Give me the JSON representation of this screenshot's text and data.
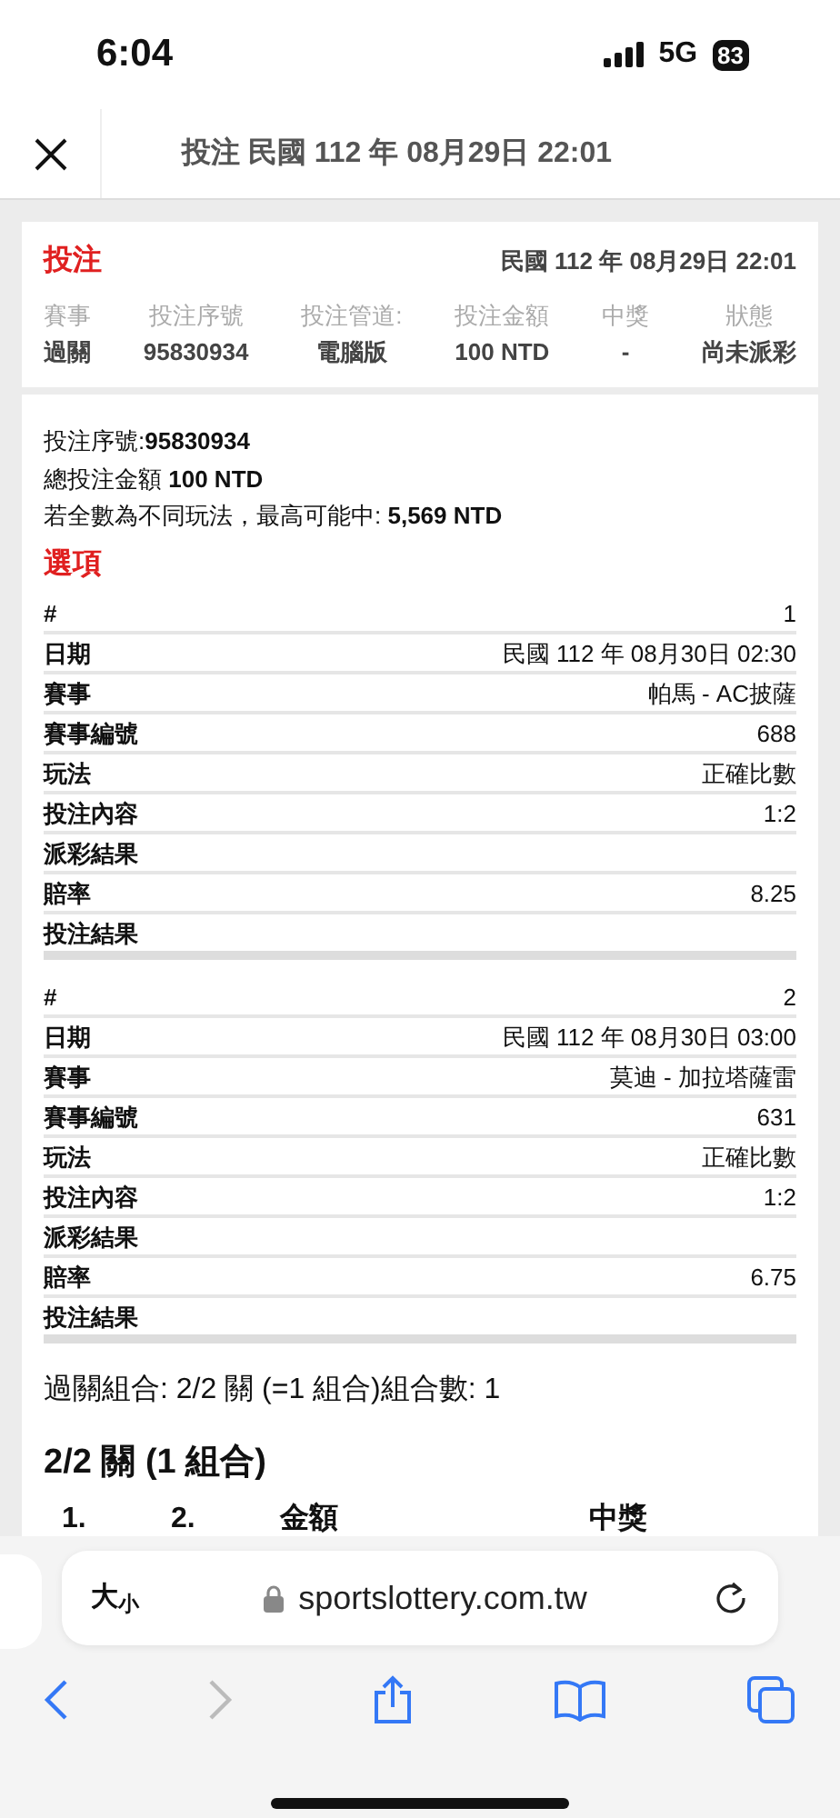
{
  "status_bar": {
    "time": "6:04",
    "network": "5G",
    "battery": "83"
  },
  "header": {
    "title": "投注 民國 112 年 08月29日 22:01"
  },
  "summary": {
    "title": "投注",
    "date": "民國 112 年 08月29日 22:01",
    "columns": [
      {
        "label": "賽事",
        "value": "過關"
      },
      {
        "label": "投注序號",
        "value": "95830934"
      },
      {
        "label": "投注管道:",
        "value": "電腦版"
      },
      {
        "label": "投注金額",
        "value": "100 NTD"
      },
      {
        "label": "中獎",
        "value": "-"
      },
      {
        "label": "狀態",
        "value": "尚未派彩"
      }
    ]
  },
  "details": {
    "lines": [
      "投注序號:**95830934**",
      "總投注金額 **100 NTD**",
      "若全數為不同玩法，最高可能中: **5,569 NTD**"
    ],
    "options_title": "選項",
    "selections": [
      [
        {
          "label": "#",
          "value": "1"
        },
        {
          "label": "日期",
          "value": "民國 112 年 08月30日 02:30"
        },
        {
          "label": "賽事",
          "value": "帕馬 - AC披薩"
        },
        {
          "label": "賽事編號",
          "value": "688"
        },
        {
          "label": "玩法",
          "value": "正確比數"
        },
        {
          "label": "投注內容",
          "value": "1:2"
        },
        {
          "label": "派彩結果"
        },
        {
          "label": "賠率",
          "value": "8.25"
        },
        {
          "label": "投注結果"
        }
      ],
      [
        {
          "label": "#",
          "value": "2"
        },
        {
          "label": "日期",
          "value": "民國 112 年 08月30日 03:00"
        },
        {
          "label": "賽事",
          "value": "莫迪 - 加拉塔薩雷"
        },
        {
          "label": "賽事編號",
          "value": "631"
        },
        {
          "label": "玩法",
          "value": "正確比數"
        },
        {
          "label": "投注內容",
          "value": "1:2"
        },
        {
          "label": "派彩結果"
        },
        {
          "label": "賠率",
          "value": "6.75"
        },
        {
          "label": "投注結果"
        }
      ]
    ],
    "combo_summary": "過關組合: 2/2 關 (=1 組合)組合數: 1",
    "combo_title": "2/2 關 (1 組合)",
    "combo_columns": [
      "1.",
      "2.",
      "金額",
      "中獎"
    ]
  },
  "browser": {
    "text_size": "大$_{小}$",
    "url": "sportslottery.com.tw",
    "back": {
      "disabled": false
    },
    "forward": {
      "disabled": true
    }
  }
}
